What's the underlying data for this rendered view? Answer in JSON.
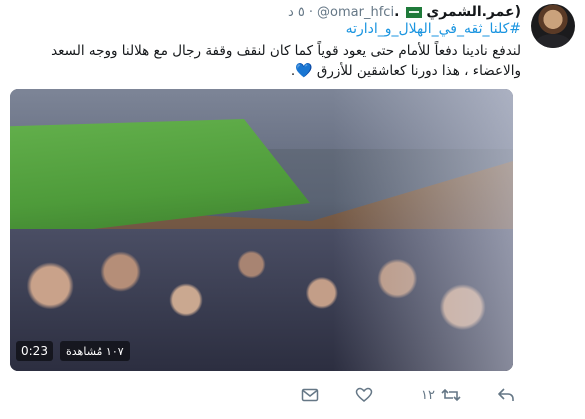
{
  "tweet": {
    "display_name": "(عمر.الشمري",
    "username": "@omar_hfci",
    "time_separator": "·",
    "timestamp": "٥ د",
    "hashtag": "#كلنا_ثقه_في_الهلال_و_ادارته",
    "text": "لندفع نادينا دفعاً للأمام حتى يعود قوياً كما كان لنقف وقفة رجال مع هلالنا ووجه السعد والاعضاء ، هذا دورنا كعاشقين للأزرق",
    "heart": "💙",
    "end_period": ".",
    "flag_country": "Saudi Arabia"
  },
  "video": {
    "views": "١٠٧ مُشاهدة",
    "duration": "0:23"
  },
  "actions": {
    "reply_icon": "reply-icon",
    "reply_count": "",
    "retweet_icon": "retweet-icon",
    "retweet_count": "١٢",
    "like_icon": "heart-icon",
    "like_count": "",
    "dm_icon": "direct-message-icon"
  },
  "colors": {
    "link": "#1b95e0",
    "muted": "#657786",
    "text": "#14171a"
  }
}
